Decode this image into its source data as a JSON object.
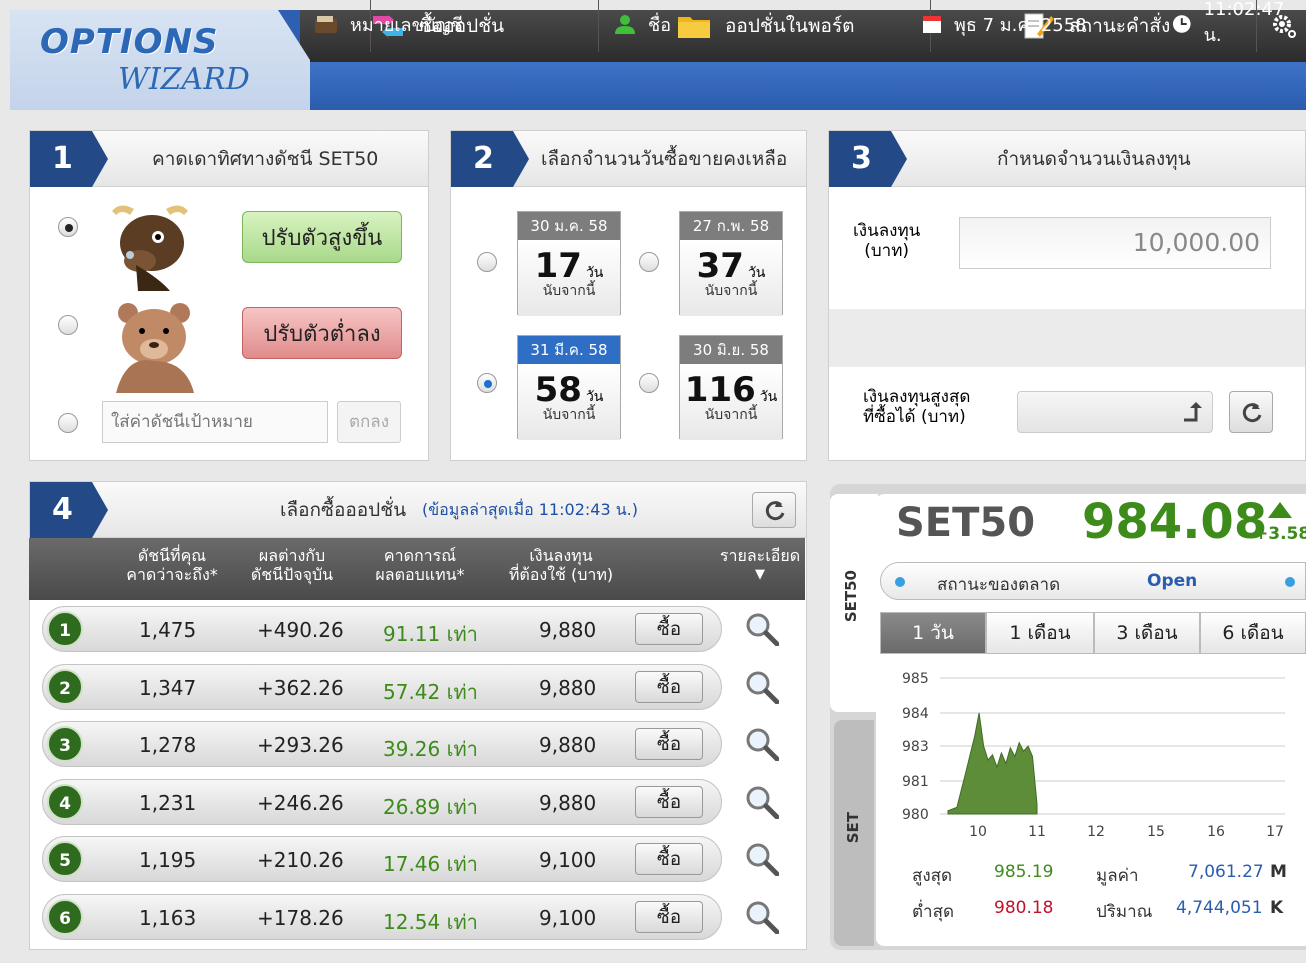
{
  "app": {
    "logo_line1": "OPTIONS",
    "logo_line2": "WIZARD"
  },
  "nav": [
    {
      "label": "ซื้อออปชั่น",
      "icon": "exchange-arrows-icon"
    },
    {
      "label": "ออปชั่นในพอร์ต",
      "icon": "folder-icon"
    },
    {
      "label": "สถานะคำสั่ง",
      "icon": "notepad-icon"
    },
    {
      "label": "",
      "icon": "gear-icon"
    }
  ],
  "subnav": {
    "account_label": "หมายเลขบัญชี",
    "name_label": "ชื่อ",
    "date": "พุธ 7 ม.ค. 2558",
    "time": "11:02:47 น."
  },
  "panel1": {
    "num": "1",
    "title": "คาดเดาทิศทางดัชนี SET50",
    "up_label": "ปรับตัวสูงขึ้น",
    "down_label": "ปรับตัวต่ำลง",
    "target_placeholder": "ใส่ค่าดัชนีเป้าหมาย",
    "ok_label": "ตกลง",
    "selected": "up"
  },
  "panel2": {
    "num": "2",
    "title": "เลือกจำนวนวันซื้อขายคงเหลือ",
    "unit": "วัน",
    "sub": "นับจากนี้",
    "cards": [
      {
        "date": "30 ม.ค. 58",
        "days": "17"
      },
      {
        "date": "27 ก.พ. 58",
        "days": "37"
      },
      {
        "date": "31 มี.ค. 58",
        "days": "58"
      },
      {
        "date": "30 มิ.ย. 58",
        "days": "116"
      }
    ],
    "selected": 2
  },
  "panel3": {
    "num": "3",
    "title": "กำหนดจำนวนเงินลงทุน",
    "invest_label_1": "เงินลงทุน",
    "invest_label_2": "(บาท)",
    "invest_value": "10,000.00",
    "max_label_1": "เงินลงทุนสูงสุด",
    "max_label_2": "ที่ซื้อได้ (บาท)",
    "max_value": ""
  },
  "panel4": {
    "num": "4",
    "title": "เลือกซื้อออปชั่น",
    "updated": "(ข้อมูลล่าสุดเมื่อ 11:02:43 น.)",
    "headers": {
      "h1a": "ดัชนีที่คุณ",
      "h1b": "คาดว่าจะถึง*",
      "h2a": "ผลต่างกับ",
      "h2b": "ดัชนีปัจจุบัน",
      "h3a": "คาดการณ์",
      "h3b": "ผลตอบแทน*",
      "h4a": "เงินลงทุน",
      "h4b": "ที่ต้องใช้ (บาท)",
      "h5": "รายละเอียด"
    },
    "buy_label": "ซื้อ",
    "rows": [
      {
        "n": "1",
        "index": "1,475",
        "diff": "+490.26",
        "ret": "91.11 เท่า",
        "cost": "9,880"
      },
      {
        "n": "2",
        "index": "1,347",
        "diff": "+362.26",
        "ret": "57.42 เท่า",
        "cost": "9,880"
      },
      {
        "n": "3",
        "index": "1,278",
        "diff": "+293.26",
        "ret": "39.26 เท่า",
        "cost": "9,880"
      },
      {
        "n": "4",
        "index": "1,231",
        "diff": "+246.26",
        "ret": "26.89 เท่า",
        "cost": "9,880"
      },
      {
        "n": "5",
        "index": "1,195",
        "diff": "+210.26",
        "ret": "17.46 เท่า",
        "cost": "9,100"
      },
      {
        "n": "6",
        "index": "1,163",
        "diff": "+178.26",
        "ret": "12.54 เท่า",
        "cost": "9,100"
      }
    ]
  },
  "market": {
    "tab_set50": "SET50",
    "tab_set": "SET",
    "symbol": "SET50",
    "price": "984.08",
    "change": "+3.58",
    "status_label": "สถานะของตลาด",
    "status": "Open",
    "periods": [
      "1 วัน",
      "1 เดือน",
      "3 เดือน",
      "6 เดือน"
    ],
    "selected_period": 0,
    "high_label": "สูงสุด",
    "high": "985.19",
    "low_label": "ต่ำสุด",
    "low": "980.18",
    "value_label": "มูลค่า",
    "value": "7,061.27",
    "value_unit": "M",
    "volume_label": "ปริมาณ",
    "volume": "4,744,051",
    "volume_unit": "K",
    "colors": {
      "up": "#3d8b1a",
      "down": "#c0122a",
      "status": "#2a5db0"
    }
  },
  "chart_data": {
    "type": "area",
    "y_ticks": [
      "985",
      "984",
      "983",
      "981",
      "980"
    ],
    "x_ticks": [
      "10",
      "11",
      "12",
      "15",
      "16",
      "17"
    ],
    "ylim": [
      980,
      985
    ],
    "x": [
      10.0,
      10.1,
      10.2,
      10.3,
      10.35,
      10.4,
      10.45,
      10.5,
      10.55,
      10.6,
      10.65,
      10.7,
      10.75,
      10.8,
      10.85,
      10.9,
      10.95,
      11.0
    ],
    "y": [
      980.1,
      980.2,
      981.5,
      983.3,
      984.0,
      983.0,
      982.2,
      982.5,
      981.8,
      982.6,
      982.0,
      982.9,
      982.4,
      983.1,
      982.7,
      983.0,
      982.4,
      980.3
    ]
  }
}
